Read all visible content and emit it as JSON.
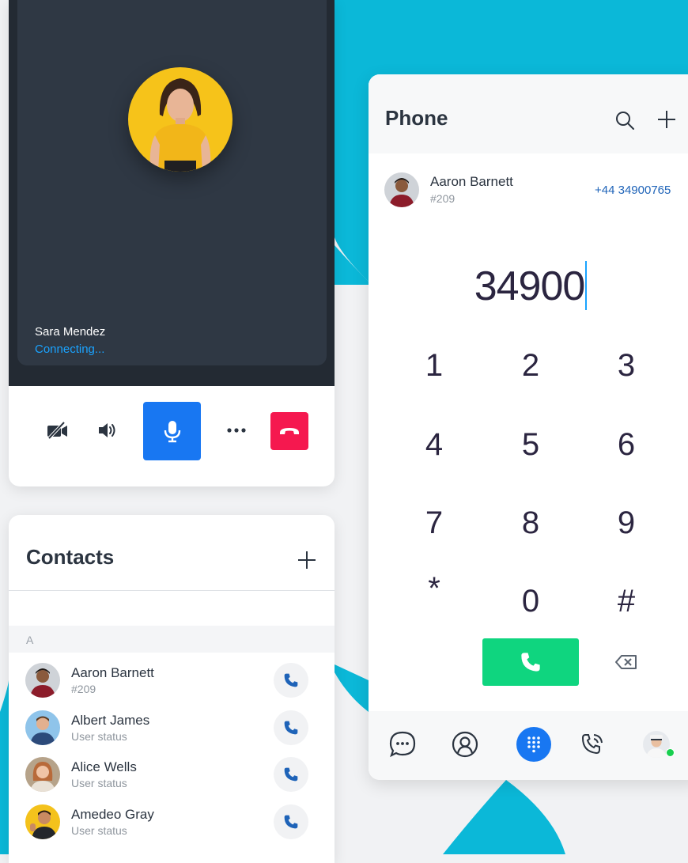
{
  "colors": {
    "accent_blue": "#1877f2",
    "teal_background": "#0bb8d8",
    "hangup_red": "#f5184f",
    "call_green": "#0fd57f",
    "connecting_blue": "#1aa3ff",
    "link_blue": "#1e63b8"
  },
  "call": {
    "caller_name": "Sara Mendez",
    "status": "Connecting...",
    "controls": [
      "video-off-icon",
      "speaker-icon",
      "microphone-icon",
      "more-icon",
      "hangup-icon"
    ]
  },
  "contacts": {
    "title": "Contacts",
    "section_letter": "A",
    "items": [
      {
        "name": "Aaron Barnett",
        "sub": "#209"
      },
      {
        "name": "Albert James",
        "sub": "User status"
      },
      {
        "name": "Alice Wells",
        "sub": "User status"
      },
      {
        "name": "Amedeo Gray",
        "sub": "User status"
      }
    ]
  },
  "phone": {
    "title": "Phone",
    "match": {
      "name": "Aaron Barnett",
      "ext": "#209",
      "number": "+44 34900765"
    },
    "dialed": "34900",
    "keys": [
      "1",
      "2",
      "3",
      "4",
      "5",
      "6",
      "7",
      "8",
      "9",
      "*",
      "0",
      "#"
    ],
    "nav": [
      "chat-icon",
      "contacts-icon",
      "dialpad-icon",
      "call-history-icon",
      "profile-avatar"
    ]
  }
}
